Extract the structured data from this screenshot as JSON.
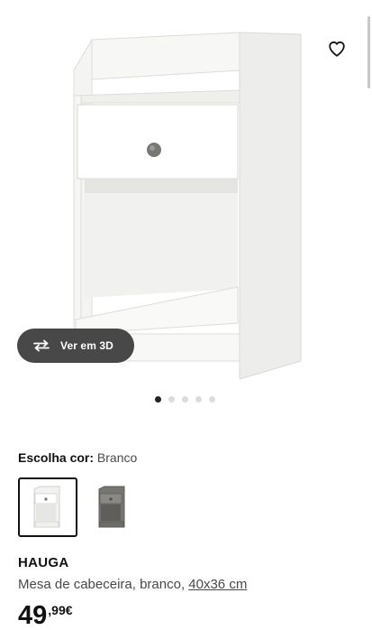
{
  "gallery": {
    "favorite_icon": "heart-icon",
    "view3d_icon": "rotate-3d-icon",
    "view3d_label": "Ver em 3D",
    "slide_count": 5,
    "active_slide": 1
  },
  "color_select": {
    "label": "Escolha cor:",
    "selected": "Branco",
    "options": [
      {
        "name": "Branco",
        "color": "#f3f3f1"
      },
      {
        "name": "Cinzento",
        "color": "#6f6e6b"
      }
    ]
  },
  "product": {
    "name": "HAUGA",
    "description": "Mesa de cabeceira, branco,",
    "size_link": "40x36 cm",
    "price_int": "49",
    "price_dec": ",99€"
  },
  "colors": {
    "button_bg": "#484848",
    "text_main": "#111111",
    "text_secondary": "#484848"
  }
}
